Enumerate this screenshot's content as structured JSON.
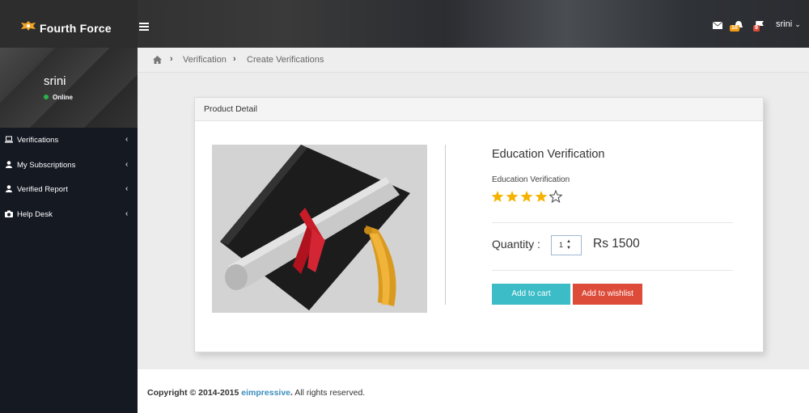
{
  "brand": {
    "name": "Fourth Force"
  },
  "header": {
    "user": "srini",
    "badges": {
      "messages": "",
      "notifications": "10",
      "tasks": "9"
    },
    "colors": {
      "messages": "#2ab34a",
      "notifications": "#f39c12",
      "tasks": "#dd4b39"
    }
  },
  "sidebar": {
    "profile": {
      "name": "srini",
      "status": "Online"
    },
    "items": [
      {
        "label": "Verifications",
        "icon": "laptop-icon"
      },
      {
        "label": "My Subscriptions",
        "icon": "user-icon"
      },
      {
        "label": "Verified Report",
        "icon": "user-icon"
      },
      {
        "label": "Help Desk",
        "icon": "camera-icon"
      }
    ]
  },
  "breadcrumb": {
    "items": [
      "Verification",
      "Create Verifications"
    ]
  },
  "panel": {
    "title": "Product Detail",
    "product": {
      "name": "Education Verification",
      "subtitle": "Education Verification",
      "rating": 4,
      "rating_max": 5,
      "quantity_label": "Quantity :",
      "quantity": "1",
      "price": "Rs 1500",
      "add_to_cart": "Add to cart",
      "add_to_wishlist": "Add to wishlist"
    }
  },
  "footer": {
    "prefix": "Copyright © 2014-2015",
    "link": "eimpressive",
    "suffix": "All rights reserved."
  },
  "colors": {
    "accent": "#3cbcc7",
    "danger": "#dd4b39",
    "star": "#f5b301",
    "link": "#3c8dbc"
  }
}
